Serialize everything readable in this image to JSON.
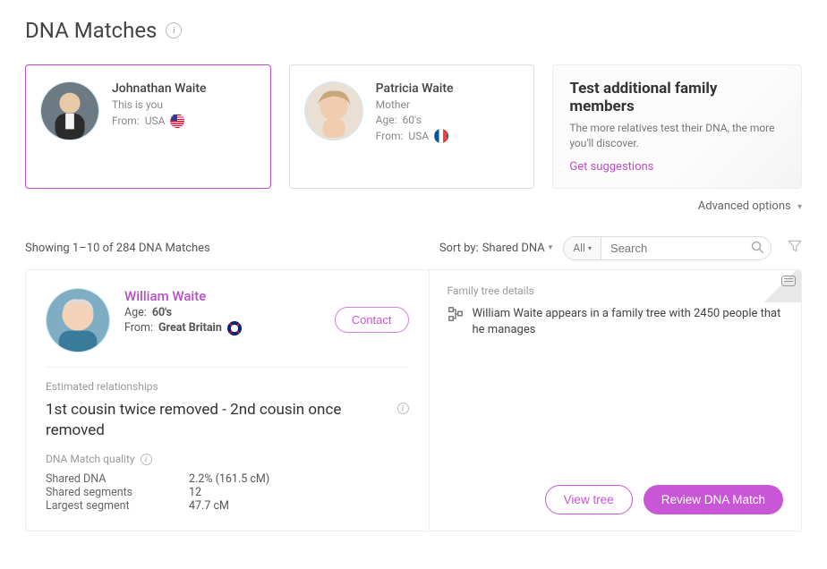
{
  "page": {
    "title": "DNA Matches"
  },
  "profiles": {
    "self": {
      "name": "Johnathan Waite",
      "subtitle": "This is you",
      "from_label": "From:",
      "from_value": "USA"
    },
    "mother": {
      "name": "Patricia Waite",
      "subtitle": "Mother",
      "age_label": "Age:",
      "age_value": "60's",
      "from_label": "From:",
      "from_value": "USA"
    }
  },
  "promo": {
    "title": "Test additional family members",
    "text": "The more relatives test their DNA, the more you'll discover.",
    "link": "Get suggestions"
  },
  "advanced_label": "Advanced options",
  "list": {
    "showing": "Showing 1–10 of 284 DNA Matches",
    "sort_label": "Sort by:",
    "sort_value": "Shared DNA",
    "filter_label": "All",
    "search_placeholder": "Search"
  },
  "match": {
    "name": "William Waite",
    "age_label": "Age:",
    "age_value": "60's",
    "from_label": "From:",
    "from_value": "Great Britain",
    "contact": "Contact",
    "est_label": "Estimated relationships",
    "relationship": "1st cousin twice removed - 2nd cousin once removed",
    "quality_label": "DNA Match quality",
    "shared_dna_k": "Shared DNA",
    "shared_dna_v": "2.2% (161.5 cM)",
    "segments_k": "Shared segments",
    "segments_v": "12",
    "largest_k": "Largest segment",
    "largest_v": "47.7 cM",
    "tree_label": "Family tree details",
    "tree_text": "William Waite appears in a family tree with 2450 people that he manages",
    "view_tree": "View tree",
    "review": "Review DNA Match"
  }
}
